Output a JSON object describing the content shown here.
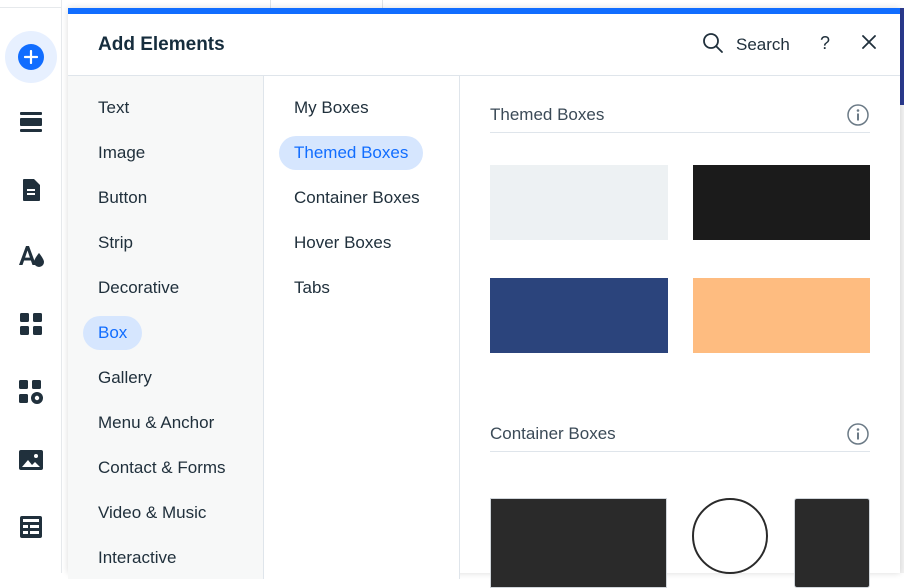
{
  "panel": {
    "title": "Add Elements",
    "search_label": "Search",
    "help_label": "?"
  },
  "left_rail": {
    "icons": [
      "add-icon",
      "sections-icon",
      "pages-icon",
      "design-icon",
      "apps-icon",
      "business-apps-icon",
      "media-icon",
      "table-icon"
    ]
  },
  "categories": [
    {
      "label": "Text"
    },
    {
      "label": "Image"
    },
    {
      "label": "Button"
    },
    {
      "label": "Strip"
    },
    {
      "label": "Decorative"
    },
    {
      "label": "Box",
      "selected": true
    },
    {
      "label": "Gallery"
    },
    {
      "label": "Menu & Anchor"
    },
    {
      "label": "Contact & Forms"
    },
    {
      "label": "Video & Music"
    },
    {
      "label": "Interactive"
    }
  ],
  "subcategories": [
    {
      "label": "My Boxes"
    },
    {
      "label": "Themed Boxes",
      "selected": true
    },
    {
      "label": "Container Boxes"
    },
    {
      "label": "Hover Boxes"
    },
    {
      "label": "Tabs"
    }
  ],
  "sections": {
    "themed": {
      "title": "Themed Boxes",
      "swatch_colors": [
        "#edf1f3",
        "#1b1b1b",
        "#2b447c",
        "#febc80"
      ]
    },
    "container": {
      "title": "Container Boxes",
      "swatch_colors": [
        "#2a2a2a",
        "#ffffff",
        "#2a2a2a"
      ]
    }
  },
  "colors": {
    "accent": "#116dff",
    "accent_light": "#d6e6fe"
  }
}
